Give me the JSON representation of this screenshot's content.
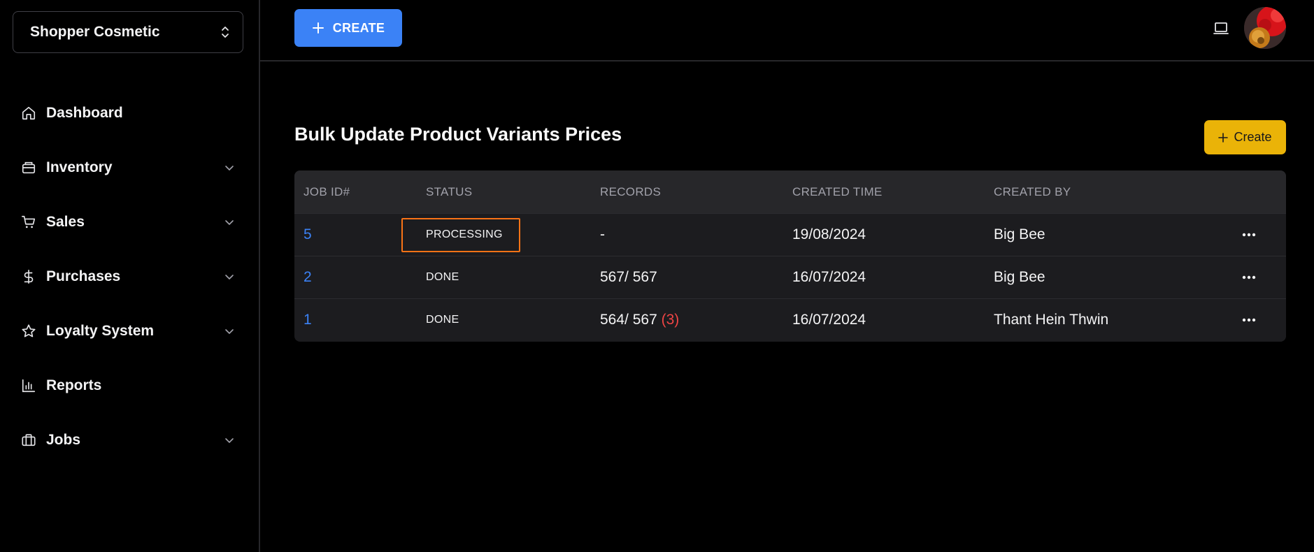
{
  "sidebar": {
    "store": "Shopper Cosmetic",
    "items": [
      {
        "label": "Dashboard",
        "icon": "home-icon",
        "expandable": false
      },
      {
        "label": "Inventory",
        "icon": "box-icon",
        "expandable": true
      },
      {
        "label": "Sales",
        "icon": "cart-icon",
        "expandable": true
      },
      {
        "label": "Purchases",
        "icon": "dollar-icon",
        "expandable": true
      },
      {
        "label": "Loyalty System",
        "icon": "star-icon",
        "expandable": true
      },
      {
        "label": "Reports",
        "icon": "bar-chart-icon",
        "expandable": false
      },
      {
        "label": "Jobs",
        "icon": "briefcase-icon",
        "expandable": true
      }
    ]
  },
  "topbar": {
    "create_label": "CREATE"
  },
  "main": {
    "title": "Bulk Update Product Variants Prices",
    "create_label": "Create",
    "columns": [
      "JOB ID#",
      "STATUS",
      "RECORDS",
      "CREATED TIME",
      "CREATED BY"
    ],
    "rows": [
      {
        "job_id": "5",
        "status": "PROCESSING",
        "records": "-",
        "errors": "",
        "created_time": "19/08/2024",
        "created_by": "Big Bee",
        "highlighted": true
      },
      {
        "job_id": "2",
        "status": "DONE",
        "records": "567/ 567",
        "errors": "",
        "created_time": "16/07/2024",
        "created_by": "Big Bee",
        "highlighted": false
      },
      {
        "job_id": "1",
        "status": "DONE",
        "records": "564/ 567",
        "errors": "(3)",
        "created_time": "16/07/2024",
        "created_by": "Thant Hein Thwin",
        "highlighted": false
      }
    ]
  },
  "colors": {
    "accent_blue": "#3b82f6",
    "accent_yellow": "#eab308",
    "highlight_orange": "#f97316",
    "error_red": "#ef4444"
  }
}
